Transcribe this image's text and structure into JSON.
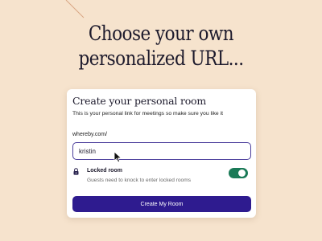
{
  "headline": {
    "line1": "Choose your own",
    "line2": "personalized URL..."
  },
  "card": {
    "title": "Create your personal room",
    "description": "This is your personal link for meetings so make sure you like it",
    "domain_prefix": "whereby.com/",
    "room_name_value": "kristin",
    "locked_room": {
      "label": "Locked room",
      "description": "Guests need to knock to enter locked rooms",
      "enabled": true
    },
    "create_button_label": "Create My Room"
  },
  "colors": {
    "background": "#f6e3cd",
    "accent": "#2e1b8f",
    "input_border": "#4b3e9c",
    "toggle_on": "#1a7a57"
  },
  "icons": {
    "lock": "lock-icon",
    "cursor": "mouse-cursor-icon"
  }
}
